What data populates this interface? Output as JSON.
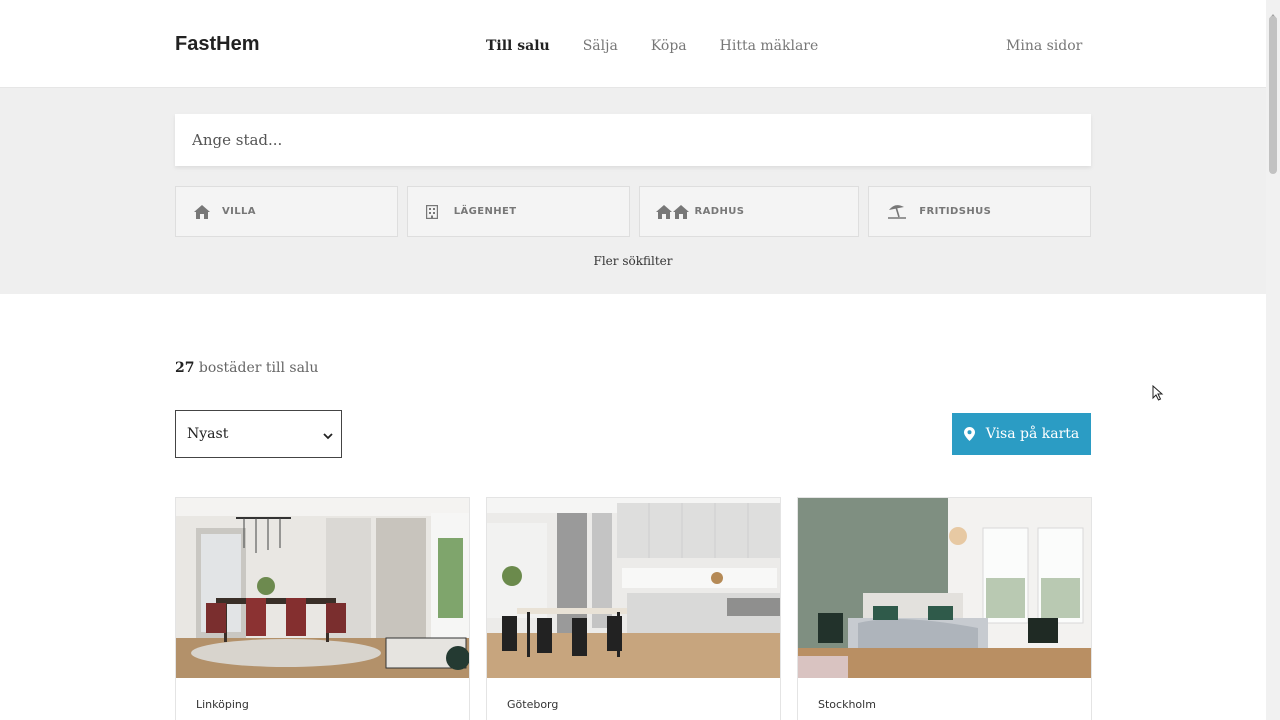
{
  "header": {
    "logo": "FastHem",
    "nav": [
      {
        "label": "Till salu",
        "active": true
      },
      {
        "label": "Sälja",
        "active": false
      },
      {
        "label": "Köpa",
        "active": false
      },
      {
        "label": "Hitta mäklare",
        "active": false
      }
    ],
    "account_label": "Mina sidor"
  },
  "search": {
    "placeholder": "Ange stad...",
    "types": [
      {
        "label": "VILLA",
        "icon": "house-icon"
      },
      {
        "label": "LÄGENHET",
        "icon": "building-icon"
      },
      {
        "label": "RADHUS",
        "icon": "townhouse-icon"
      },
      {
        "label": "FRITIDSHUS",
        "icon": "umbrella-beach-icon"
      }
    ],
    "more_filters": "Fler sökfilter"
  },
  "results": {
    "count": "27",
    "count_suffix": " bostäder till salu",
    "sort_selected": "Nyast",
    "map_button": "Visa på karta",
    "map_icon": "map-pin-icon"
  },
  "listings": [
    {
      "city": "Linköping"
    },
    {
      "city": "Göteborg"
    },
    {
      "city": "Stockholm"
    }
  ],
  "colors": {
    "accent": "#2b9cc4",
    "band": "#efefef"
  }
}
